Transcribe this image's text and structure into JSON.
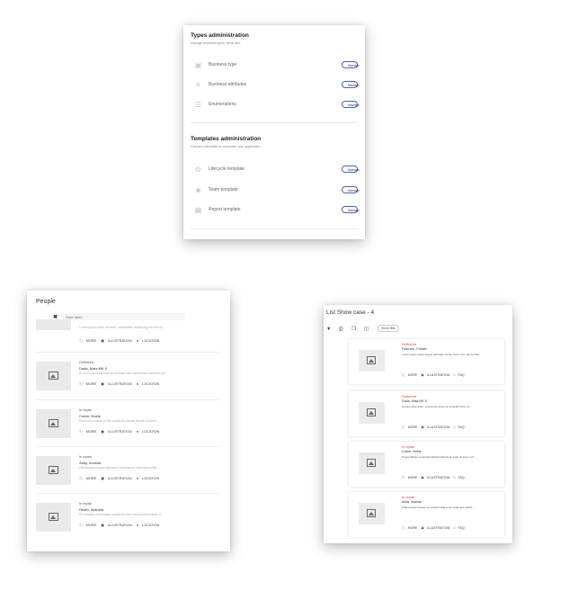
{
  "types_admin": {
    "title": "Types administration",
    "subtitle": "Manage business types, items and",
    "manage_label": "Manage",
    "rows": [
      {
        "label": "Business type",
        "icon": "building-icon"
      },
      {
        "label": "Business attributes",
        "icon": "attributes-icon"
      },
      {
        "label": "Enumerations",
        "icon": "list-icon"
      }
    ]
  },
  "templates_admin": {
    "title": "Templates administration",
    "subtitle": "Choose a template to customize your application",
    "rows": [
      {
        "label": "Lifecycle template",
        "icon": "gears-icon"
      },
      {
        "label": "Team template",
        "icon": "team-icon"
      },
      {
        "label": "Report template",
        "icon": "report-icon"
      }
    ]
  },
  "people": {
    "title": "People",
    "filter_placeholder": "Filter table",
    "meta": {
      "more": "MORE",
      "illustration": "ILLUSTRATION",
      "location": "LOCATION"
    },
    "top_desc": "Lorem ipsum dolor sit amet, consectetur adipiscing elit sed do",
    "items": [
      {
        "status": "Delivered",
        "name": "Dada, Maia MK 5",
        "desc": "At vero eos et accusamus et iusto odio dignissimos ducimus qui"
      },
      {
        "status": "In repair",
        "name": "Culver, Noble",
        "desc": "Pretium in massa id elit sollicitudin lacinia blandit sit amet ..."
      },
      {
        "status": "In repair",
        "name": "Addy, Imanira",
        "desc": "Ullamcorper augue dignissim molestie ac nulla sed mattis ..."
      },
      {
        "status": "In repair",
        "name": "Heath, Nubarta",
        "desc": "Et convallis scelerisque mauris id enim urna condimentum ut"
      }
    ]
  },
  "showcase": {
    "title": "List Show case - 4",
    "chip": "Show filter",
    "meta": {
      "more": "MORE",
      "illustration": "ILLUSTRATION",
      "faq": "FAQ"
    },
    "items": [
      {
        "status": "Delivered",
        "name": "Peterson, Fedder",
        "desc": "Lorem eget cosgu augue dernique curae nunc nunc purus plas"
      },
      {
        "status": "Delivered",
        "name": "Dada, Maia MK 5",
        "desc": "Cursus ante diam, commodo amet sit ceraphis dolor sit"
      },
      {
        "status": "In repair",
        "name": "Culver, Noble",
        "desc": "Suspendisse venenatis lacinia blandit sit amet sit lorem sit ..."
      },
      {
        "status": "In repair",
        "name": "Addy, Imanira",
        "desc": "Ullamcorper laoreet a suscipit nulla et ac nulla sed mattis ..."
      }
    ],
    "colors": {
      "status": "#e23b3b"
    }
  }
}
